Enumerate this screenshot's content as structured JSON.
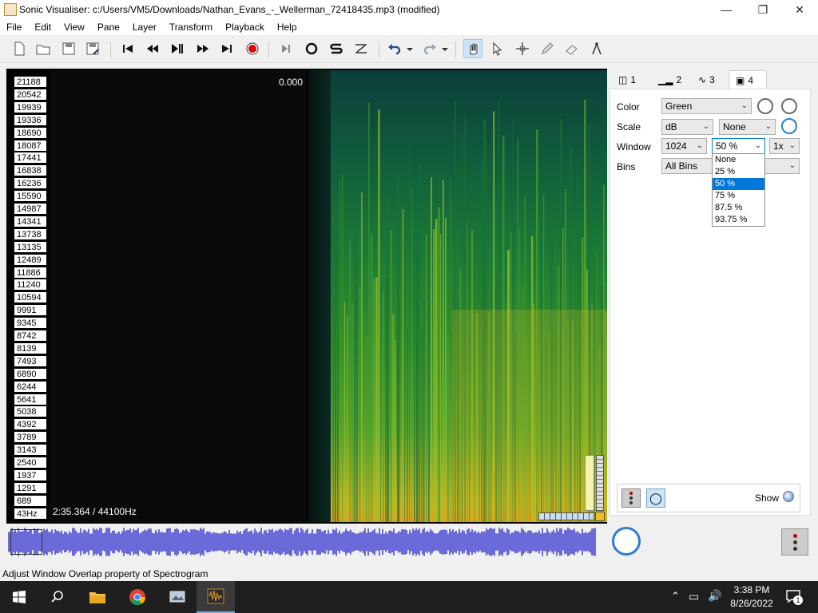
{
  "window": {
    "title": "Sonic Visualiser: c:/Users/VM5/Downloads/Nathan_Evans_-_Wellerman_72418435.mp3 (modified)",
    "controls": [
      "minimize-icon",
      "restore-icon",
      "close-icon"
    ]
  },
  "menu": [
    "File",
    "Edit",
    "View",
    "Pane",
    "Layer",
    "Transform",
    "Playback",
    "Help"
  ],
  "toolbar": {
    "icons": [
      "new-file-icon",
      "open-icon",
      "save-icon",
      "save-as-icon",
      "rewind-start-icon",
      "rewind-icon",
      "play-pause-icon",
      "fast-forward-icon",
      "forward-end-icon",
      "record-icon",
      "play-selection-icon",
      "loop-icon",
      "solo-icon",
      "speed-icon",
      "undo-icon",
      "redo-icon",
      "navigate-icon",
      "select-icon",
      "move-icon",
      "draw-icon",
      "erase-icon",
      "measure-icon"
    ],
    "active_tool": "navigate-icon"
  },
  "pane": {
    "frequency_labels": [
      "21188",
      "20542",
      "19939",
      "19336",
      "18690",
      "18087",
      "17441",
      "16838",
      "16236",
      "15590",
      "14987",
      "14341",
      "13738",
      "13135",
      "12489",
      "11886",
      "11240",
      "10594",
      "9991",
      "9345",
      "8742",
      "8139",
      "7493",
      "6890",
      "6244",
      "5641",
      "5038",
      "4392",
      "3789",
      "3143",
      "2540",
      "1937",
      "1291",
      "689",
      "43Hz"
    ],
    "top_value": "0.000",
    "top_marker": "0",
    "position_readout": "2:35.364 / 44100Hz"
  },
  "layer_tabs": [
    {
      "label": "1",
      "icon": "pane-icon"
    },
    {
      "label": "2",
      "icon": "spectrum-icon"
    },
    {
      "label": "3",
      "icon": "waveform-icon"
    },
    {
      "label": "4",
      "icon": "spectrogram-icon"
    }
  ],
  "properties": {
    "color_label": "Color",
    "color_value": "Green",
    "scale_label": "Scale",
    "scale_value": "dB",
    "normalize_value": "None",
    "window_label": "Window",
    "window_size": "1024",
    "window_overlap": "50 %",
    "oversample": "1x",
    "bins_label": "Bins",
    "bins_value": "All Bins",
    "overlap_options": [
      "None",
      "25 %",
      "50 %",
      "75 %",
      "87.5 %",
      "93.75 %"
    ],
    "overlap_selected": "50 %",
    "show_label": "Show"
  },
  "status": "Adjust Window Overlap property of Spectrogram",
  "taskbar": {
    "time": "3:38 PM",
    "date": "8/26/2022",
    "notification_count": "1",
    "apps": [
      "start-icon",
      "search-icon",
      "file-explorer-icon",
      "chrome-icon",
      "media-icon",
      "sonic-visualiser-icon"
    ]
  },
  "colors": {
    "accent": "#0078d7",
    "overview_wave": "#6a6ad8",
    "spectrogram_low": "#0b3f3a",
    "spectrogram_high": "#e8a020"
  }
}
